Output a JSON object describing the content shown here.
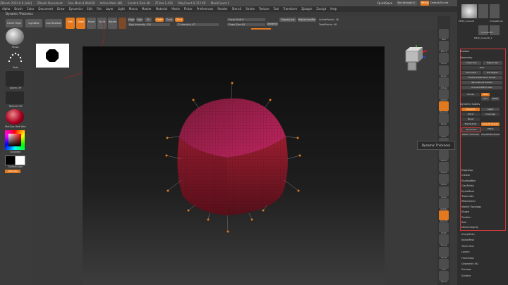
{
  "titlebar": {
    "items": [
      "ZBrush 2022.0.6 [x64]",
      "ZBrush Document",
      "Free Mem 8.964GB",
      "Active Mem 481",
      "Scratch Disk 48",
      "ZTime 1.435",
      "PolyCount 0.372 KP",
      "MeshCount 1"
    ],
    "quicksave": "QuickSave",
    "see_through": "See-through 0",
    "menus_label": "Menus",
    "script_label": "DefaultZScript"
  },
  "menubar": [
    "Alpha",
    "Brush",
    "Color",
    "Document",
    "Draw",
    "Dynamics",
    "Edit",
    "File",
    "Layer",
    "Light",
    "Macro",
    "Marker",
    "Material",
    "Movie",
    "Picker",
    "Preferences",
    "Render",
    "Stencil",
    "Stroke",
    "Texture",
    "Tool",
    "Transform",
    "Zplugin",
    "Zscript",
    "Help"
  ],
  "subtitle": "Dynamic Thickness",
  "toolbar": {
    "home_page": "Home Page",
    "lightbox": "LightBox",
    "live_boolean": "Live Boolean",
    "edit": "Edit",
    "draw": "Draw",
    "move": "Move",
    "scale": "Scale",
    "rotate": "Rotate",
    "mrgb": "Mrgb",
    "rgb": "Rgb",
    "m": "M",
    "zadd": "Zadd",
    "zsub": "Zsub",
    "zcut": "Zcut",
    "rgb_intensity": "Rgb Intensity 100",
    "z_intensity": "Z Intensity 47",
    "focal_shift": "Focal Shift 0",
    "draw_size": "Draw Size 64",
    "dynamic": "Dynamic",
    "replay_last": "ReplayLast",
    "replay_last_rel": "ReplayLastRel",
    "active_points": "ActivePoints: 2K",
    "total_points": "TotalPoints: 4K"
  },
  "left_panel": {
    "brush_label": "Move",
    "stroke_label": "Dots",
    "alpha_label": "Alpha Off",
    "texture_label": "Texture Off",
    "material_label": "MatCap Red Wax",
    "gradient_label": "Gradient",
    "switch_color": "SwitchColor",
    "alternate": "Alternate"
  },
  "right_strip": {
    "labels": [
      "BPR",
      "SPix 3",
      "Scroll",
      "Zoom",
      "Actual",
      "AAHalf",
      "Dynamic",
      "Persp",
      "Floor",
      "Local",
      "Gizmo",
      "Frame",
      "Move",
      "Scale",
      "Rotate",
      "Line Fill",
      "PolyF",
      "Transp",
      "Ghost",
      "Solo",
      "Xpose"
    ]
  },
  "tool_panel": {
    "subtool": "Subtool",
    "geometry": "Geometry",
    "lower_res": "Lower Res",
    "higher_res": "Higher Res",
    "sdiv": "SDiv",
    "del_lower": "Del Lower",
    "del_higher": "Del Higher",
    "freeze": "Freeze SubDivision Levels",
    "reconstruct": "Reconstruct Subdiv",
    "convert_bpr": "Convert BPR To Geo",
    "divide": "Divide",
    "smt": "Smt",
    "suv": "Suv",
    "rsuv": "ReUV",
    "dynamic_subdiv": "Dynamic Subdiv",
    "dynamic": "Dynamic",
    "apply": "Apply",
    "qgrid": "QGrid",
    "coverage": "Coverage",
    "bevel": "Bevel",
    "flat_subdiv": "Flat Subdiv",
    "smooth_subdiv": "Smooth Subdiv",
    "thickness": "Thickness",
    "offset": "Offset",
    "mesh_thickness": "Mesh Thickness",
    "smooth_thickness": "SmoothThickness",
    "modify_list": [
      "Edgeloop",
      "Crease",
      "ShadowBox",
      "ClayPolish",
      "DynaMesh",
      "Tessimate",
      "ZRemesher",
      "Modify Topology",
      "Shape",
      "Position",
      "Size",
      "MeshIntegrity"
    ],
    "more_list": [
      "ArrayMesh",
      "NanoMesh",
      "Thick Skin",
      "Layers",
      "FiberMesh",
      "Geometry HD",
      "Preview",
      "Surface"
    ]
  },
  "tool_thumbs": [
    "PM3D_Cube3D",
    "Cylinder3D",
    "SimpleBrush",
    "PM3D_Cube3D_1"
  ],
  "tooltip": "Dynamic Thickness",
  "colors": {
    "accent": "#e2791f",
    "highlight_box": "#d23a3a",
    "mesh": "#8c1a3a",
    "mesh_top": "#b8235a"
  }
}
